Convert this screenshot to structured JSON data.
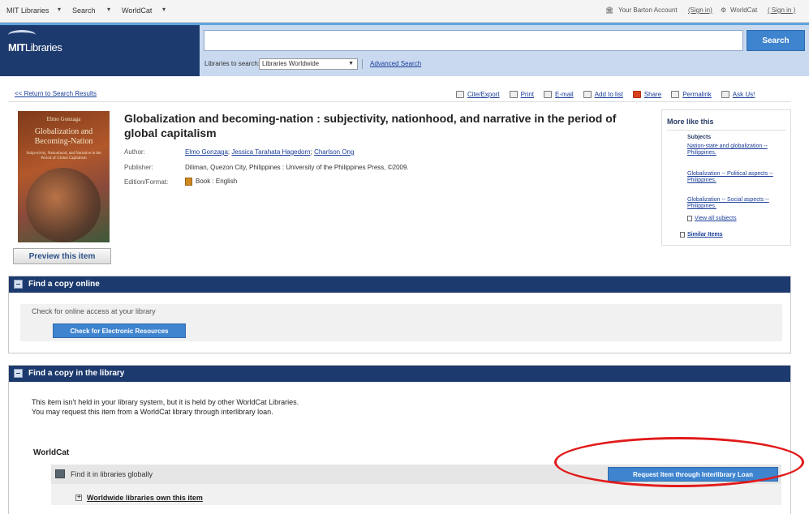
{
  "topnav": {
    "items": [
      "MIT Libraries",
      "Search",
      "WorldCat"
    ],
    "account_text": "Your Barton Account",
    "account_signin": "(Sign in)",
    "worldcat_text": "WorldCat",
    "worldcat_signin": "( Sign in )"
  },
  "header": {
    "logo_bold": "MIT",
    "logo_light": "Libraries",
    "search_button": "Search",
    "search_value": "",
    "libraries_label": "Libraries to search:",
    "libraries_selected": "Libraries Worldwide",
    "advanced_search": "Advanced Search"
  },
  "toolbar": {
    "back_link": "<< Return to Search Results",
    "items": [
      "Cite/Export",
      "Print",
      "E-mail",
      "Add to list",
      "Share",
      "Permalink",
      "Ask Us!"
    ]
  },
  "book": {
    "cover_author": "Elmo Gonzaga",
    "cover_title": "Globalization and Becoming-Nation",
    "cover_subtitle": "Subjectivity, Nationhood, and Narrative in the Period of Global Capitalism",
    "title": "Globalization and becoming-nation : subjectivity, nationhood, and narrative in the period of global capitalism",
    "author_label": "Author:",
    "authors": [
      "Elmo Gonzaga",
      "Jessica Tarahata Hagedorn",
      "Charlson Ong"
    ],
    "publisher_label": "Publisher:",
    "publisher": "Diliman, Quezon City, Philippines : University of the Philippines Press, ©2009.",
    "format_label": "Edition/Format:",
    "format": "Book : English",
    "preview_button": "Preview this item"
  },
  "more_like_this": {
    "heading": "More like this",
    "subjects_label": "Subjects",
    "subjects": [
      "Nation-state and globalization -- Philippines.",
      "Globalization -- Political aspects -- Philippines.",
      "Globalization -- Social aspects -- Philippines."
    ],
    "view_all": "View all subjects",
    "similar": "Similar Items"
  },
  "online": {
    "section_title": "Find a copy online",
    "check_label": "Check for online access at your library",
    "check_button": "Check for Electronic Resources"
  },
  "library": {
    "section_title": "Find a copy in the library",
    "line1": "This item isn't held in your library system, but it is held by other WorldCat Libraries.",
    "line2": "You may request this item from a WorldCat library through interlibrary loan.",
    "worldcat_heading": "WorldCat",
    "find_globally": "Find it in libraries globally",
    "request_button": "Request Item through Interlibrary Loan",
    "worldwide_link": "Worldwide libraries own this item"
  },
  "colors": {
    "header_bg": "#1d3a6e",
    "button_blue": "#3e84cf",
    "annotation_red": "#e11a1a"
  }
}
